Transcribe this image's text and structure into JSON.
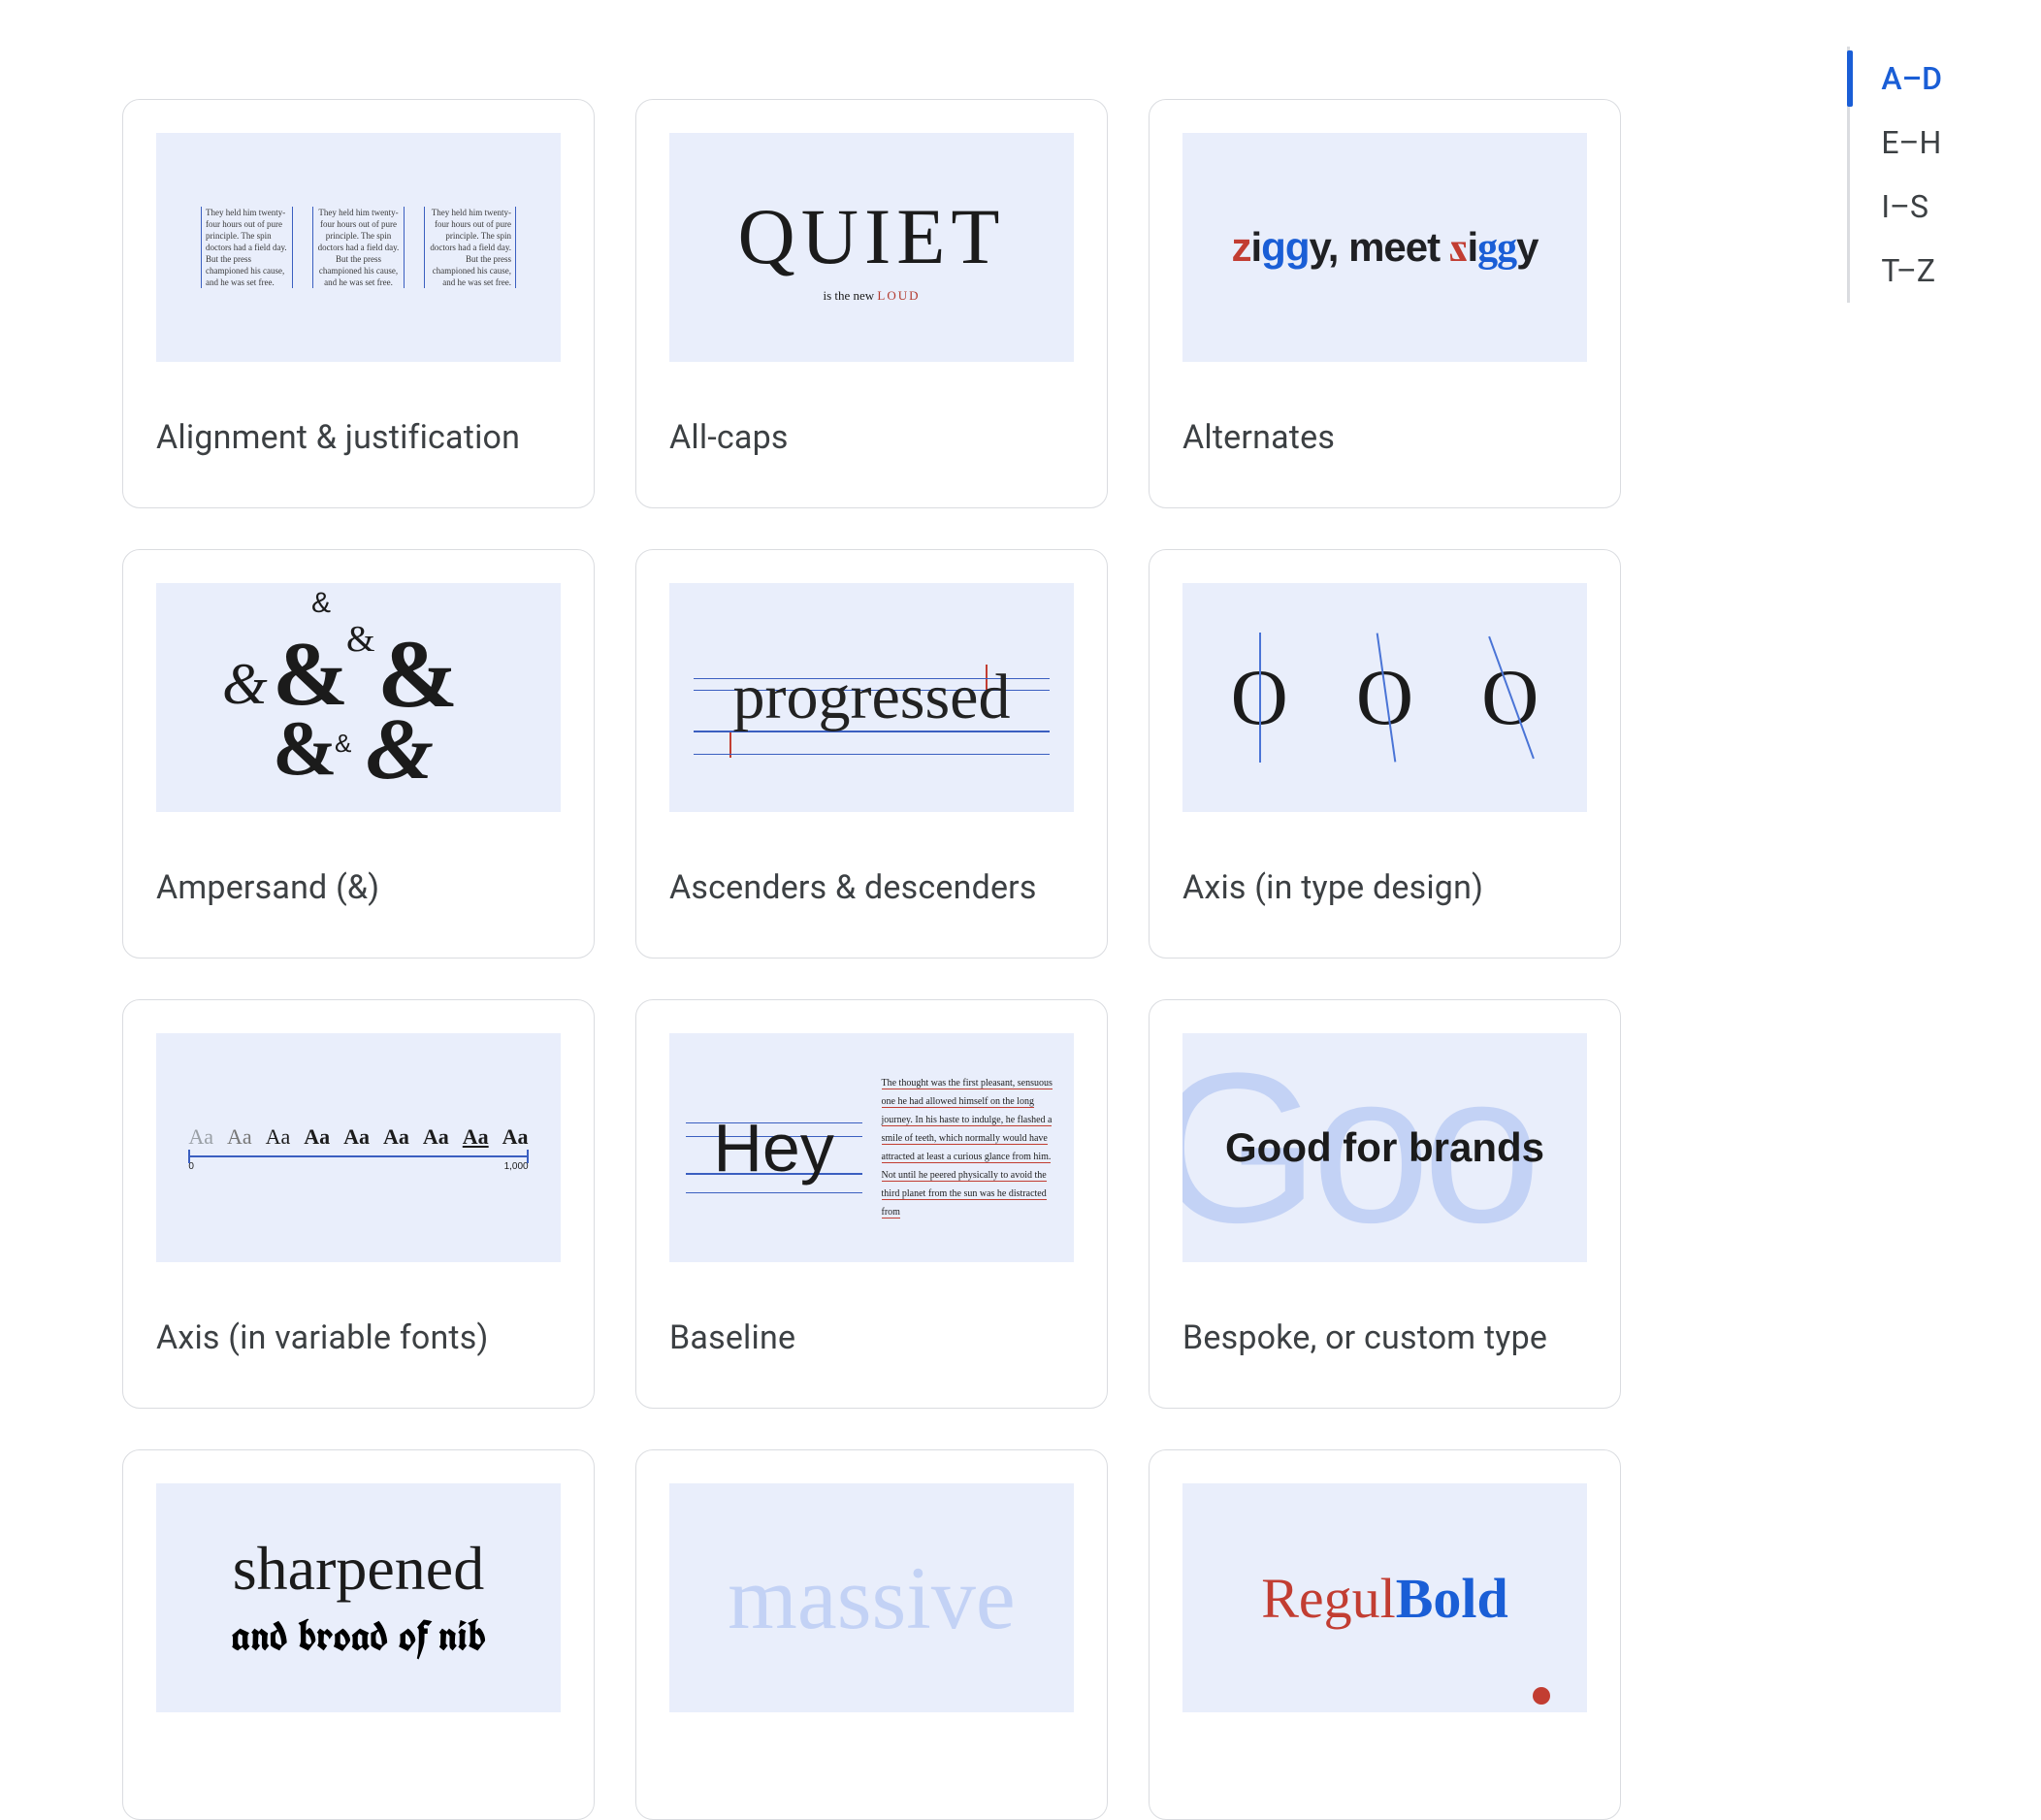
{
  "toc": {
    "items": [
      "A–D",
      "E–H",
      "I–S",
      "T–Z"
    ],
    "active_index": 0
  },
  "cards": [
    {
      "title": "Alignment & justification"
    },
    {
      "title": "All-caps"
    },
    {
      "title": "Alternates"
    },
    {
      "title": "Ampersand (&)"
    },
    {
      "title": "Ascenders & descenders"
    },
    {
      "title": "Axis (in type design)"
    },
    {
      "title": "Axis (in variable fonts)"
    },
    {
      "title": "Baseline"
    },
    {
      "title": "Bespoke, or custom type"
    },
    {
      "title": ""
    },
    {
      "title": ""
    },
    {
      "title": ""
    }
  ],
  "thumbs": {
    "alignment_sample": "They held him twenty-four hours out of pure principle. The spin doctors had a field day. But the press championed his cause, and he was set free.",
    "allcaps_main": "QUIET",
    "allcaps_sub_prefix": "is the new ",
    "allcaps_sub_loud": "LOUD",
    "alternates_text": "ziggy, meet ziggy",
    "alternates_parts": {
      "z1": "z",
      "i1": "i",
      "gg1": "gg",
      "y1": "y",
      "comma": ", meet ",
      "z2": "z",
      "i2": "i",
      "gg2": "gg",
      "y2": "y"
    },
    "ascenders_word": "progressed",
    "axis_design_glyph": "O",
    "axis_var_sample": "Aa",
    "axis_var_min": "0",
    "axis_var_max": "1,000",
    "baseline_word": "Hey",
    "baseline_para": "The thought was the first pleasant, sensuous one he had allowed himself on the long journey. In his haste to indulge, he flashed a smile of teeth, which normally would have attracted at least a curious glance from him. Not until he peered physically to avoid the third planet from the sun was he distracted from",
    "bespoke_bg": "Goo",
    "bespoke_fg": "Good for brands",
    "callig_l1": "sharpened",
    "callig_l2": "and broad of nib",
    "massive": "massive",
    "regbold_reg": "Regul",
    "regbold_bold": "Bold"
  }
}
